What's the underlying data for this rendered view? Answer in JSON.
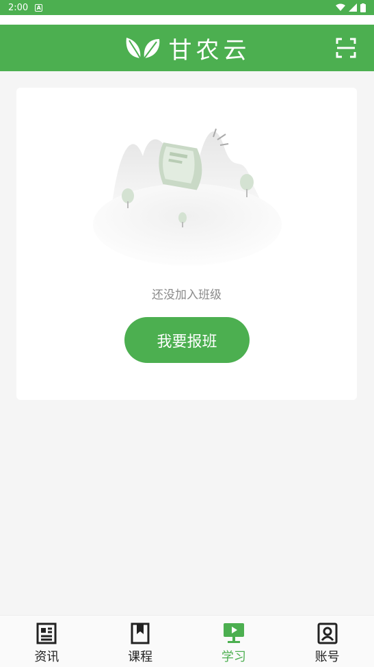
{
  "status_bar": {
    "time": "2:00"
  },
  "header": {
    "title": "甘农云",
    "logo_icon": "leaf-icon",
    "scan_icon": "scan-icon"
  },
  "empty_state": {
    "message": "还没加入班级",
    "button_label": "我要报班"
  },
  "tabs": [
    {
      "label": "资讯",
      "icon": "news-icon",
      "active": false
    },
    {
      "label": "课程",
      "icon": "bookmark-book-icon",
      "active": false
    },
    {
      "label": "学习",
      "icon": "monitor-play-icon",
      "active": true
    },
    {
      "label": "账号",
      "icon": "account-icon",
      "active": false
    }
  ],
  "colors": {
    "primary": "#4caf50",
    "text_muted": "#8a8a8a"
  }
}
